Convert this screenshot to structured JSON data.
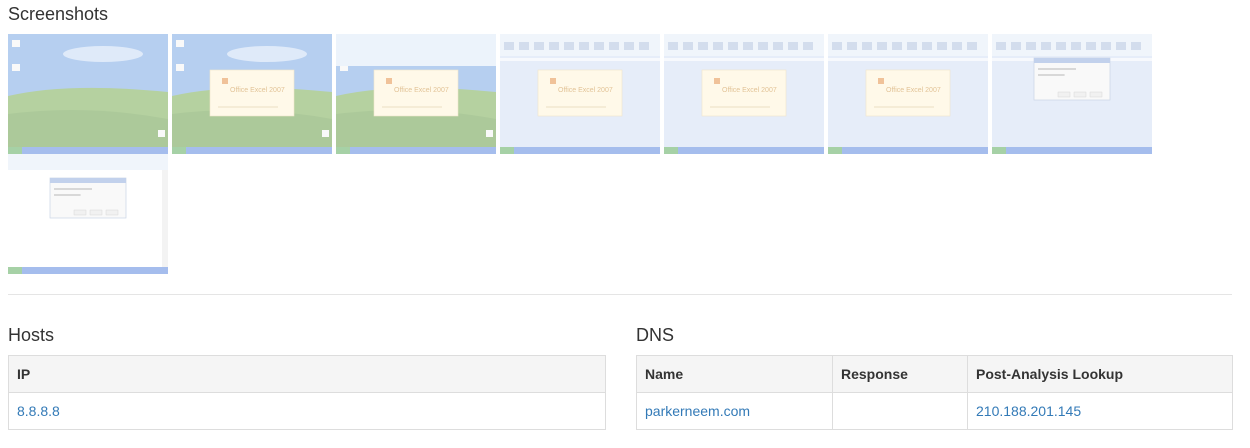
{
  "screenshots": {
    "title": "Screenshots",
    "thumbnails": [
      {
        "kind": "desktop"
      },
      {
        "kind": "desktop-splash",
        "splash_text": "Office Excel 2007"
      },
      {
        "kind": "blank-splash",
        "splash_text": "Office Excel 2007"
      },
      {
        "kind": "excel-splash",
        "splash_text": "Office Excel 2007"
      },
      {
        "kind": "excel-splash",
        "splash_text": "Office Excel 2007"
      },
      {
        "kind": "excel-splash",
        "splash_text": "Office Excel 2007"
      },
      {
        "kind": "excel-dialog"
      },
      {
        "kind": "document-dialog"
      }
    ]
  },
  "hosts": {
    "title": "Hosts",
    "columns": [
      "IP"
    ],
    "rows": [
      [
        "8.8.8.8"
      ]
    ]
  },
  "dns": {
    "title": "DNS",
    "columns": [
      "Name",
      "Response",
      "Post-Analysis Lookup"
    ],
    "rows": [
      [
        "parkerneem.com",
        "",
        "210.188.201.145"
      ]
    ]
  }
}
